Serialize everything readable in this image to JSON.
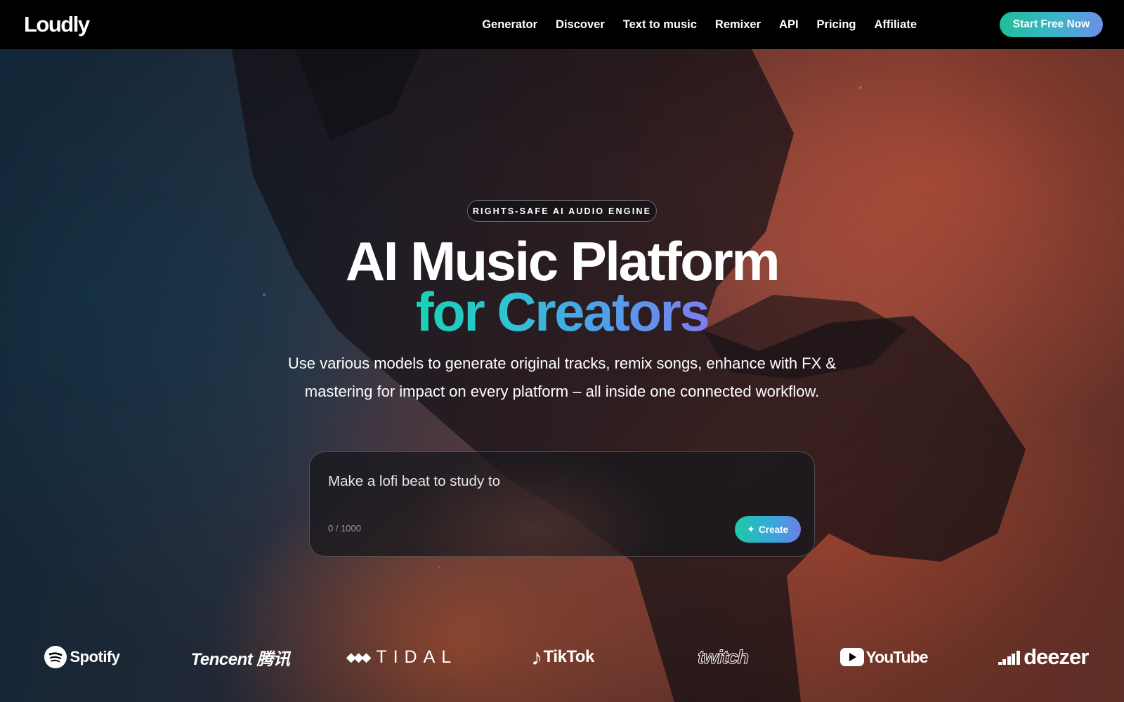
{
  "brand": {
    "logo": "Loudly"
  },
  "nav": {
    "links": [
      "Generator",
      "Discover",
      "Text to music",
      "Remixer",
      "API",
      "Pricing",
      "Affiliate"
    ],
    "cta": "Start Free Now"
  },
  "hero": {
    "badge": "RIGHTS-SAFE AI AUDIO ENGINE",
    "title_line1": "AI Music Platform",
    "title_line2": "for Creators",
    "subtitle_line1": "Use various models to generate original tracks, remix songs, enhance with FX &",
    "subtitle_line2": "mastering for impact on every platform – all inside one connected workflow."
  },
  "prompt": {
    "placeholder": "Make a lofi beat to study to",
    "counter": "0 / 1000",
    "create_label": "Create",
    "create_icon": "sparkle-icon"
  },
  "partners": {
    "spotify": "Spotify",
    "tencent": "Tencent 腾讯",
    "tidal": "TIDAL",
    "tiktok": "TikTok",
    "twitch": "twitch",
    "youtube": "YouTube",
    "deezer": "deezer"
  },
  "colors": {
    "accent_start": "#1fbf9a",
    "accent_end": "#6d8fea",
    "nav_bg": "#000000"
  }
}
